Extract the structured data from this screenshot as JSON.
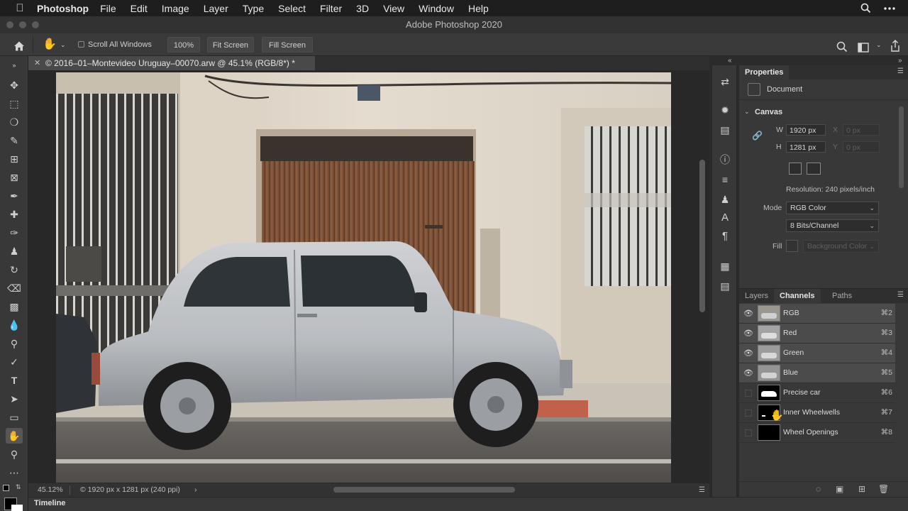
{
  "menubar": {
    "app_name": "Photoshop",
    "items": [
      "File",
      "Edit",
      "Image",
      "Layer",
      "Type",
      "Select",
      "Filter",
      "3D",
      "View",
      "Window",
      "Help"
    ]
  },
  "window": {
    "title": "Adobe Photoshop 2020"
  },
  "options": {
    "scroll_all_windows": "Scroll All Windows",
    "zoom_value": "100%",
    "fit_screen": "Fit Screen",
    "fill_screen": "Fill Screen"
  },
  "document": {
    "tab_title": "© 2016–01–Montevideo Uruguay–00070.arw @ 45.1% (RGB/8*) *"
  },
  "status": {
    "zoom": "45.12%",
    "info": "© 1920 px x 1281 px (240 ppi)"
  },
  "timeline": {
    "label": "Timeline"
  },
  "properties": {
    "tab": "Properties",
    "kind": "Document",
    "section": "Canvas",
    "w_label": "W",
    "w_value": "1920 px",
    "h_label": "H",
    "h_value": "1281 px",
    "x_label": "X",
    "x_value": "0 px",
    "y_label": "Y",
    "y_value": "0 px",
    "resolution": "Resolution: 240 pixels/inch",
    "mode_label": "Mode",
    "mode_value": "RGB Color",
    "depth_value": "8 Bits/Channel",
    "fill_label": "Fill",
    "fill_value": "Background Color"
  },
  "channels_panel": {
    "tabs": [
      "Layers",
      "Channels",
      "Paths"
    ],
    "active_tab": "Channels",
    "rows": [
      {
        "name": "RGB",
        "key": "⌘2",
        "visible": true
      },
      {
        "name": "Red",
        "key": "⌘3",
        "visible": true
      },
      {
        "name": "Green",
        "key": "⌘4",
        "visible": true
      },
      {
        "name": "Blue",
        "key": "⌘5",
        "visible": true
      },
      {
        "name": "Precise car",
        "key": "⌘6",
        "visible": false
      },
      {
        "name": "Inner Wheelwells",
        "key": "⌘7",
        "visible": false
      },
      {
        "name": "Wheel Openings",
        "key": "⌘8",
        "visible": false
      }
    ]
  },
  "colors": {
    "accent": "#383838",
    "background": "#2b2b2b",
    "selection": "#4b4b4b"
  }
}
